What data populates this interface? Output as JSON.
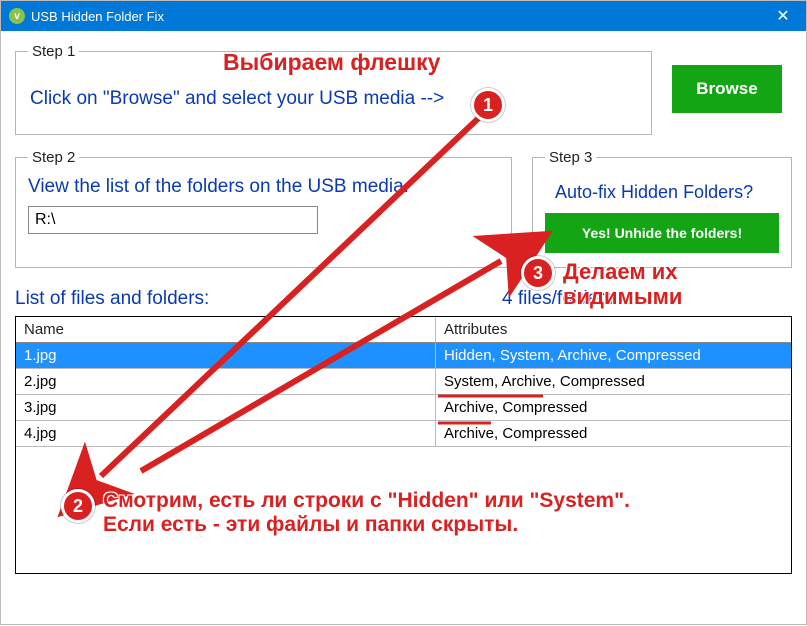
{
  "window": {
    "title": "USB Hidden Folder Fix",
    "close_glyph": "✕",
    "icon_letter": "v"
  },
  "step1": {
    "legend": "Step 1",
    "instruction": "Click on \"Browse\" and select your USB media -->",
    "browse_label": "Browse"
  },
  "step2": {
    "legend": "Step 2",
    "instruction": "View the list of the folders on the USB media.",
    "path_value": "R:\\"
  },
  "step3": {
    "legend": "Step 3",
    "question": "Auto-fix Hidden Folders?",
    "fix_label": "Yes! Unhide the folders!"
  },
  "list": {
    "heading": "List of files and folders:",
    "count_label": "4 files/folders",
    "col_name": "Name",
    "col_attr": "Attributes",
    "rows": [
      {
        "name": "1.jpg",
        "attr": "Hidden, System, Archive, Compressed",
        "selected": true
      },
      {
        "name": "2.jpg",
        "attr": "System, Archive, Compressed",
        "selected": false
      },
      {
        "name": "3.jpg",
        "attr": "Archive, Compressed",
        "selected": false
      },
      {
        "name": "4.jpg",
        "attr": "Archive, Compressed",
        "selected": false
      }
    ]
  },
  "annotations": {
    "badge1": "1",
    "badge2": "2",
    "badge3": "3",
    "text_top": "Выбираем флешку",
    "text_right_line1": "Делаем их",
    "text_right_line2": "видимыми",
    "text_bottom_line1": "Смотрим, есть ли строки с \"Hidden\" или \"System\".",
    "text_bottom_line2": "Если есть - эти файлы и папки скрыты."
  }
}
